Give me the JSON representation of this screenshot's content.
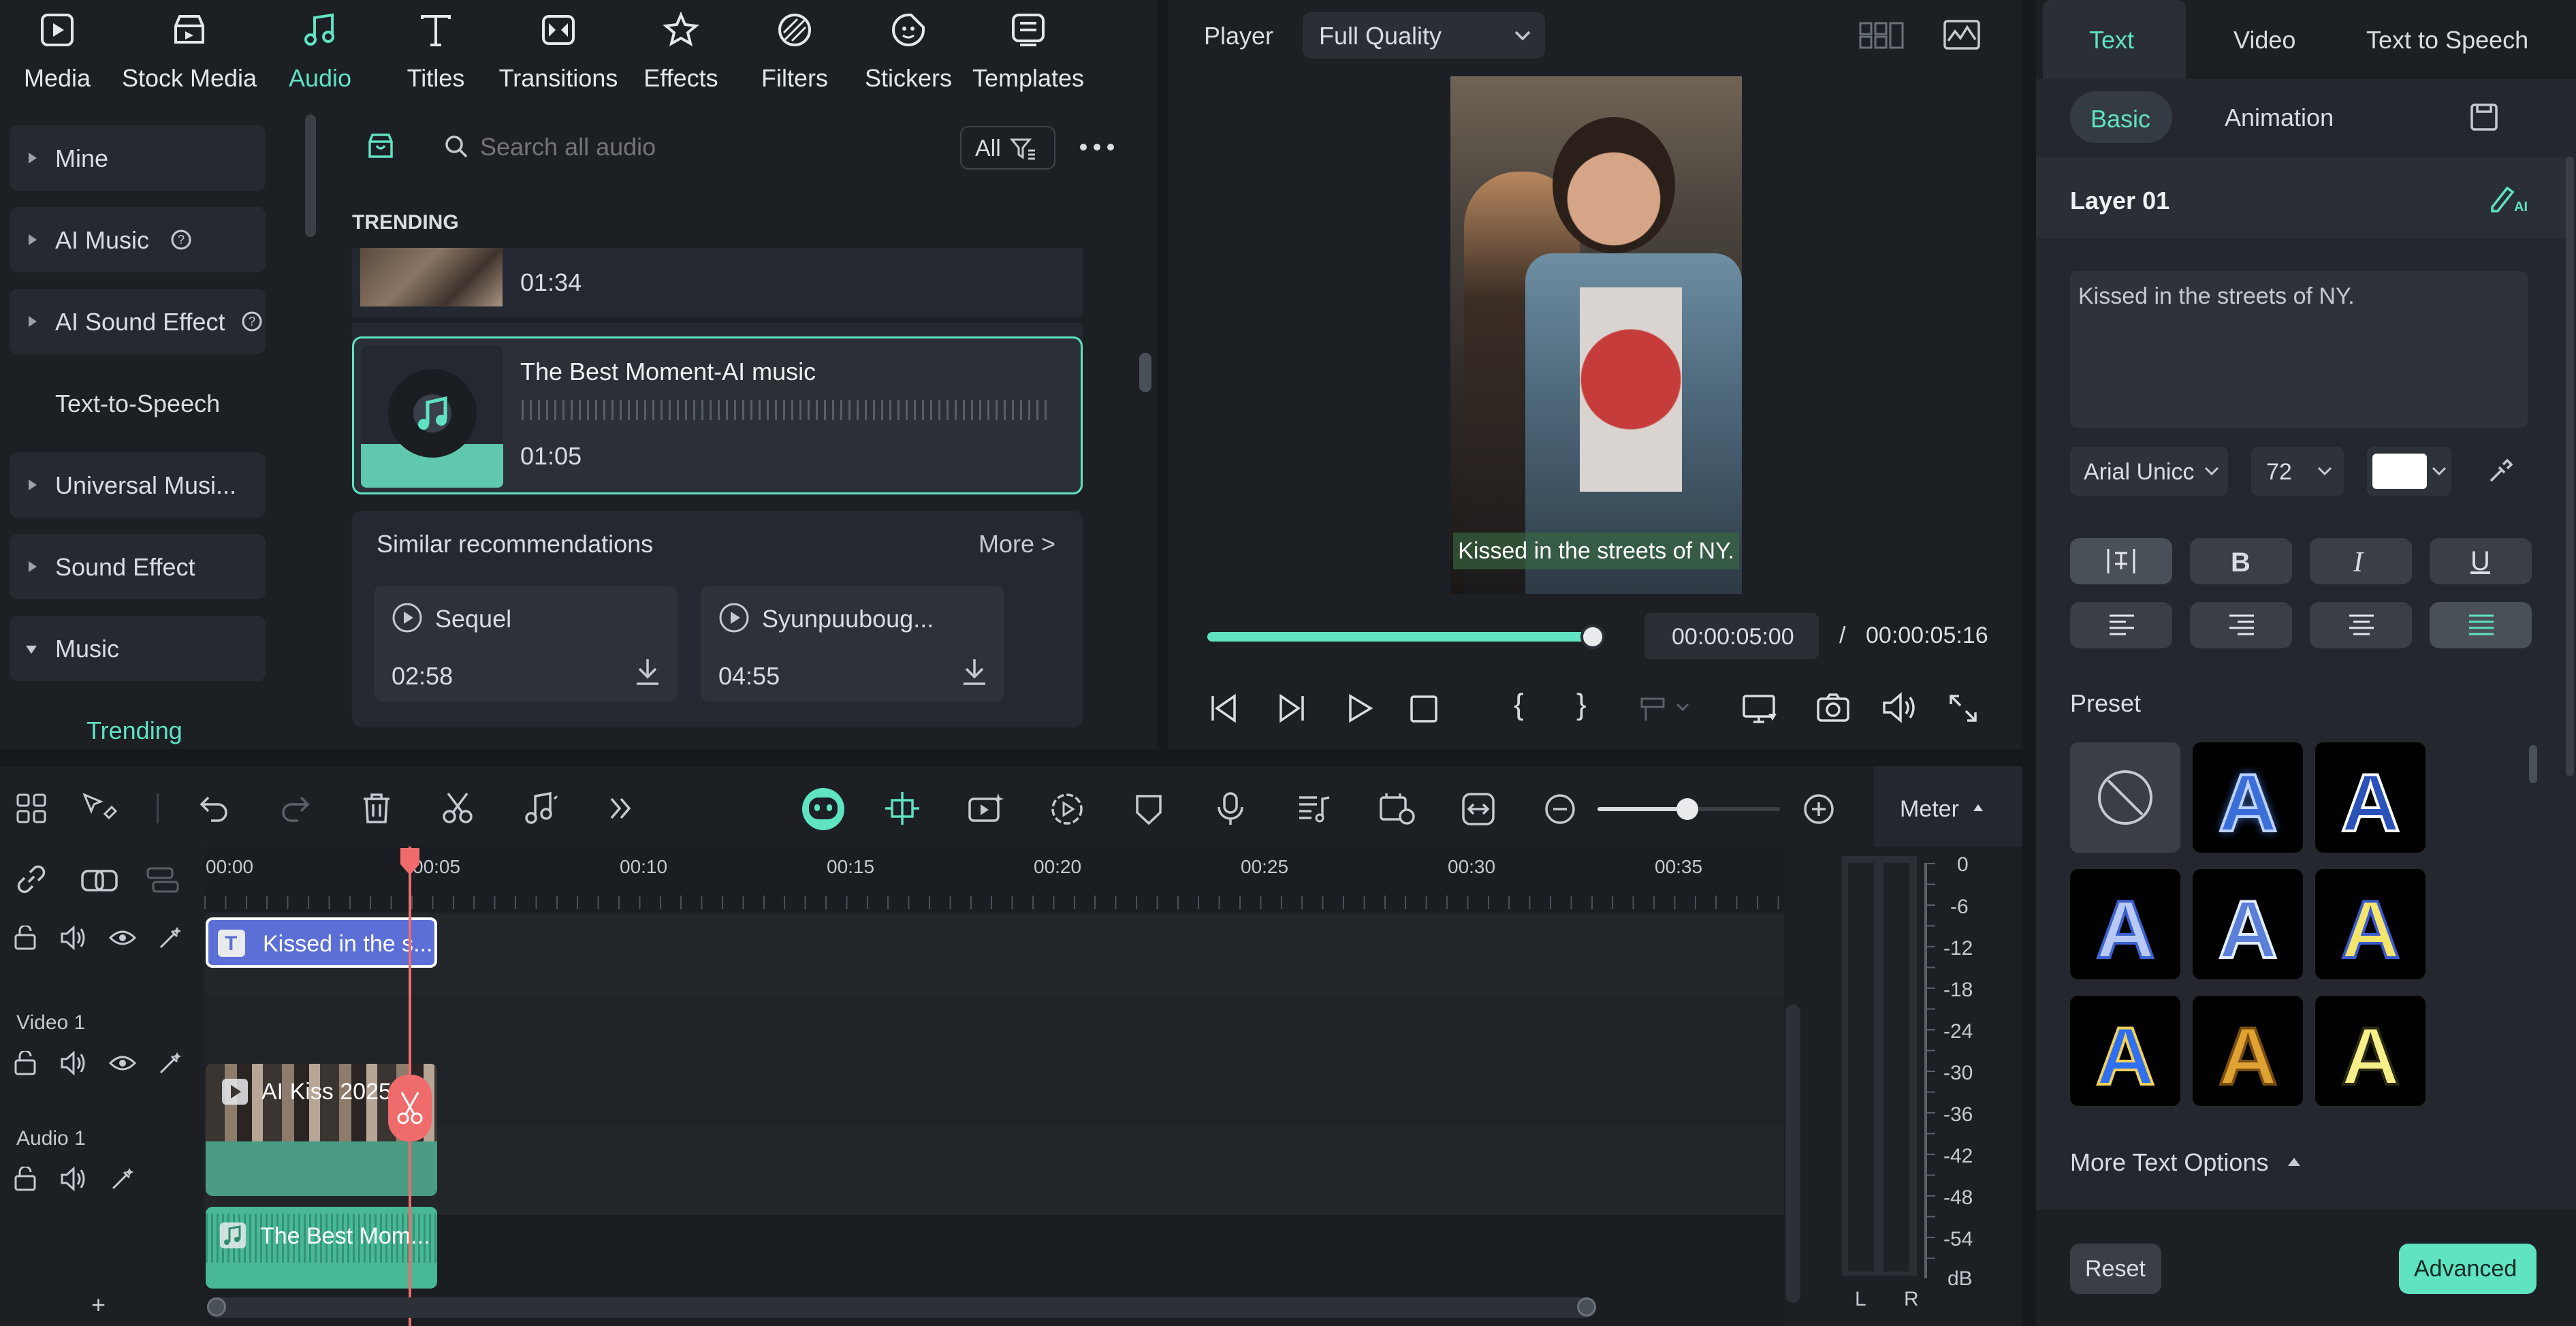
{
  "top_tabs": [
    {
      "label": "Media",
      "icon": "media-icon",
      "active": false
    },
    {
      "label": "Stock Media",
      "icon": "stock-media-icon",
      "active": false
    },
    {
      "label": "Audio",
      "icon": "music-note-icon",
      "active": true
    },
    {
      "label": "Titles",
      "icon": "titles-icon",
      "active": false
    },
    {
      "label": "Transitions",
      "icon": "transitions-icon",
      "active": false
    },
    {
      "label": "Effects",
      "icon": "effects-icon",
      "active": false
    },
    {
      "label": "Filters",
      "icon": "filters-icon",
      "active": false
    },
    {
      "label": "Stickers",
      "icon": "stickers-icon",
      "active": false
    },
    {
      "label": "Templates",
      "icon": "templates-icon",
      "active": false
    }
  ],
  "categories": {
    "mine": "Mine",
    "ai_music": "AI Music",
    "ai_sound_effect": "AI Sound Effect",
    "tts": "Text-to-Speech",
    "universal": "Universal Musi...",
    "sound_effect": "Sound Effect",
    "music": "Music",
    "trending": "Trending"
  },
  "audio": {
    "search_placeholder": "Search all audio",
    "filter_label": "All",
    "section_title": "TRENDING",
    "prev_item_duration": "01:34",
    "selected_item": {
      "title": "The Best Moment-AI music",
      "duration": "01:05"
    },
    "similar": {
      "title": "Similar recommendations",
      "more": "More >",
      "items": [
        {
          "title": "Sequel",
          "duration": "02:58"
        },
        {
          "title": "Syunpuuboug...",
          "duration": "04:55"
        }
      ]
    }
  },
  "player": {
    "label": "Player",
    "quality": "Full Quality",
    "caption": "Kissed in the streets of NY.",
    "current_time": "00:00:05:00",
    "separator": "/",
    "total_time": "00:00:05:16",
    "progress": 0.97
  },
  "right_panel": {
    "tabs": {
      "text": "Text",
      "video": "Video",
      "tts": "Text to Speech"
    },
    "subtabs": {
      "basic": "Basic",
      "animation": "Animation"
    },
    "layer_label": "Layer 01",
    "text_value": "Kissed in the streets of NY.",
    "font": "Arial Unicc",
    "font_size": "72",
    "preset_label": "Preset",
    "more_options": "More Text Options",
    "reset": "Reset",
    "advanced": "Advanced",
    "accent_color": "#5fe3c0"
  },
  "timeline": {
    "meter_label": "Meter",
    "ruler": [
      "00:00",
      "00:05",
      "00:10",
      "00:15",
      "00:20",
      "00:25",
      "00:30",
      "00:35"
    ],
    "tracks": {
      "video_label": "Video 1",
      "audio_label": "Audio 1",
      "text_clip": "Kissed in the s...",
      "video_clip": "AI Kiss 2025",
      "audio_clip": "The Best Mom..."
    },
    "meter_scale": [
      "0",
      "-6",
      "-12",
      "-18",
      "-24",
      "-30",
      "-36",
      "-42",
      "-48",
      "-54",
      "dB"
    ],
    "meter_channels": {
      "left": "L",
      "right": "R"
    },
    "add_track": "+"
  }
}
